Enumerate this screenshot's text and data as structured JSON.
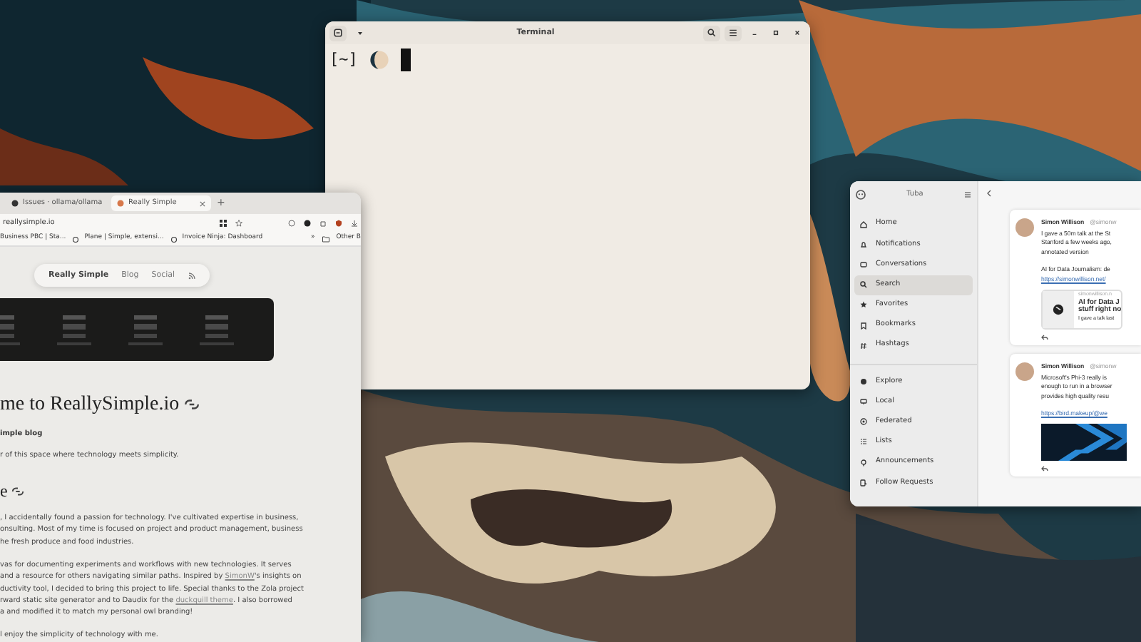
{
  "browser": {
    "tabs": [
      {
        "label": "Issues · ollama/ollama",
        "selected": false
      },
      {
        "label": "Really Simple",
        "selected": true
      }
    ],
    "new_tab": "+",
    "address": "reallysimple.io",
    "bookmarks": [
      "Business PBC | Sta...",
      "Plane | Simple, extensi...",
      "Invoice Ninja: Dashboard"
    ],
    "bookmarks_overflow": "»",
    "other_bookmarks": "Other B"
  },
  "site": {
    "nav": [
      {
        "label": "Really Simple",
        "selected": true
      },
      {
        "label": "Blog",
        "selected": false
      },
      {
        "label": "Social",
        "selected": false
      }
    ],
    "heading": "me to ReallySimple.io",
    "subtitle": "imple blog",
    "intro": "r of this space where technology meets simplicity.",
    "section_heading": "e",
    "paragraphs": [
      [
        [
          {
            "kind": "text",
            "text": ", I accidentally found a passion for technology. I've cultivated expertise in business,"
          }
        ],
        [
          {
            "kind": "text",
            "text": "onsulting. Most of my time is focused on project and product management, business"
          }
        ],
        [
          {
            "kind": "text",
            "text": "he fresh produce and food industries."
          }
        ]
      ],
      [
        [
          {
            "kind": "text",
            "text": "vas for documenting experiments and workflows with new technologies. It serves"
          }
        ],
        [
          {
            "kind": "text",
            "text": "and a resource for others navigating similar paths. Inspired by "
          },
          {
            "kind": "link",
            "text": "SimonW"
          },
          {
            "kind": "text",
            "text": "'s insights on"
          }
        ],
        [
          {
            "kind": "text",
            "text": "ductivity tool, I decided to bring this project to life. Special thanks to the Zola project"
          }
        ],
        [
          {
            "kind": "text",
            "text": "rward static site generator and to Daudix for the "
          },
          {
            "kind": "link",
            "text": "duckquill theme"
          },
          {
            "kind": "text",
            "text": ". I also borrowed"
          }
        ],
        [
          {
            "kind": "text",
            "text": "a and modified it to match my personal owl branding!"
          }
        ]
      ],
      [
        [
          {
            "kind": "text",
            "text": "l enjoy the simplicity of technology with me."
          }
        ]
      ]
    ]
  },
  "terminal": {
    "title": "Terminal",
    "prompt": "[~]"
  },
  "tuba": {
    "title": "Tuba",
    "nav_groups": [
      [
        {
          "label": "Home",
          "selected": false
        },
        {
          "label": "Notifications",
          "selected": false
        },
        {
          "label": "Conversations",
          "selected": false
        },
        {
          "label": "Search",
          "selected": true
        },
        {
          "label": "Favorites",
          "selected": false
        },
        {
          "label": "Bookmarks",
          "selected": false
        },
        {
          "label": "Hashtags",
          "selected": false
        }
      ],
      [
        {
          "label": "Explore",
          "selected": false
        },
        {
          "label": "Local",
          "selected": false
        },
        {
          "label": "Federated",
          "selected": false
        },
        {
          "label": "Lists",
          "selected": false
        },
        {
          "label": "Announcements",
          "selected": false
        },
        {
          "label": "Follow Requests",
          "selected": false
        }
      ]
    ],
    "posts": [
      {
        "author": "Simon Willison",
        "handle": "@simonw",
        "paragraphs": [
          [
            "I gave a 50m talk at the St",
            "Stanford a few weeks ago,",
            "annotated version"
          ],
          [
            "AI for Data Journalism: de"
          ]
        ],
        "link": "https://simonwillison.net/",
        "card": {
          "site": "simonwillison.n",
          "title": [
            "AI for Data J",
            "stuff right no"
          ],
          "excerpt": "I gave a talk last"
        }
      },
      {
        "author": "Simon Willison",
        "handle": "@simonw",
        "paragraphs": [
          [
            "Microsoft's Phi-3 really is",
            "enough to run in a browser",
            "provides high quality resu"
          ]
        ],
        "link": "https://bird.makeup/@we",
        "media": {
          "kind": "picture"
        }
      }
    ]
  }
}
